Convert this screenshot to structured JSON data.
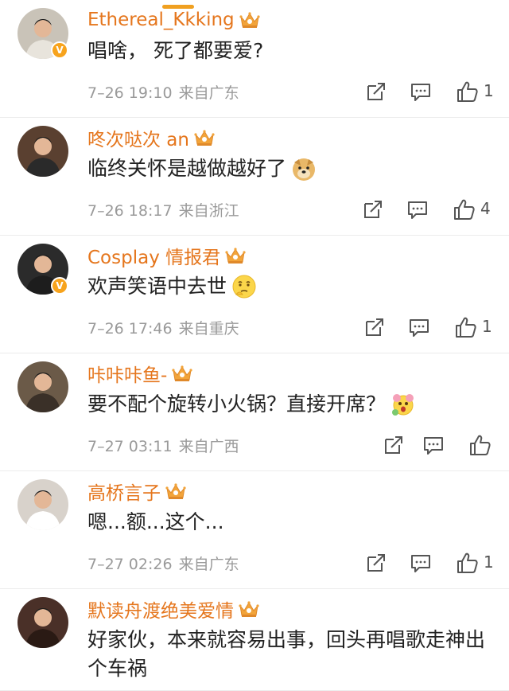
{
  "comments": [
    {
      "username": "Ethereal_Kkking",
      "text": "唱啥， 死了都要爱?",
      "time": "7–26 19:10",
      "location": "来自广东",
      "likes": "1",
      "verified": true,
      "emoji": "",
      "avatar_color": "#c9c3b8"
    },
    {
      "username": "咚次哒次 an",
      "text": "临终关怀是越做越好了",
      "time": "7–26 18:17",
      "location": "来自浙江",
      "likes": "4",
      "verified": false,
      "emoji": "doge-emoji",
      "avatar_color": "#5a4030"
    },
    {
      "username": "Cosplay 情报君",
      "text": "欢声笑语中去世",
      "time": "7–26 17:46",
      "location": "来自重庆",
      "likes": "1",
      "verified": true,
      "emoji": "thinking-emoji",
      "avatar_color": "#2b2b2b"
    },
    {
      "username": "咔咔咔鱼-",
      "text": "要不配个旋转小火锅？直接开席？",
      "time": "7–27 03:11",
      "location": "来自广西",
      "likes": "",
      "verified": false,
      "emoji": "flower-face-emoji",
      "avatar_color": "#6b5a48"
    },
    {
      "username": "高桥言子",
      "text": "嗯...额...这个...",
      "time": "7–27 02:26",
      "location": "来自广东",
      "likes": "1",
      "verified": false,
      "emoji": "",
      "avatar_color": "#d8d2cb"
    },
    {
      "username": "默读舟渡绝美爱情",
      "text": "好家伙，本来就容易出事，回头再唱歌走神出个车祸",
      "time": "",
      "location": "",
      "likes": "",
      "verified": false,
      "emoji": "",
      "avatar_color": "#4a3028"
    }
  ],
  "colors": {
    "username": "#e5761d",
    "meta": "#9a9a9a",
    "text": "#222222"
  },
  "icons": [
    "crown-icon",
    "repost-icon",
    "comment-icon",
    "like-icon"
  ]
}
